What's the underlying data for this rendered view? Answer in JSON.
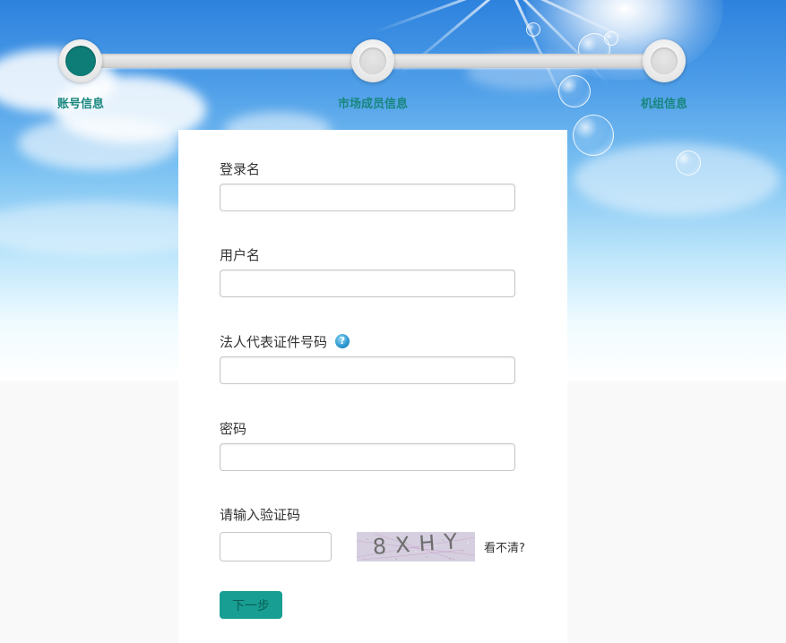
{
  "steps": [
    {
      "label": "账号信息",
      "active": true
    },
    {
      "label": "市场成员信息",
      "active": false
    },
    {
      "label": "机组信息",
      "active": false
    }
  ],
  "form": {
    "login_name": {
      "label": "登录名",
      "value": "",
      "placeholder": ""
    },
    "user_name": {
      "label": "用户名",
      "value": "",
      "placeholder": ""
    },
    "legal_rep_id": {
      "label": "法人代表证件号码",
      "value": "",
      "placeholder": "",
      "help_icon": "question-icon"
    },
    "password": {
      "label": "密码",
      "value": "",
      "placeholder": ""
    },
    "captcha": {
      "label": "请输入验证码",
      "value": "",
      "image_text": "8XHY",
      "refresh_label": "看不清?"
    },
    "next_label": "下一步"
  },
  "colors": {
    "accent": "#17867d",
    "button": "#189e92",
    "active_step": "#0e7d77"
  }
}
